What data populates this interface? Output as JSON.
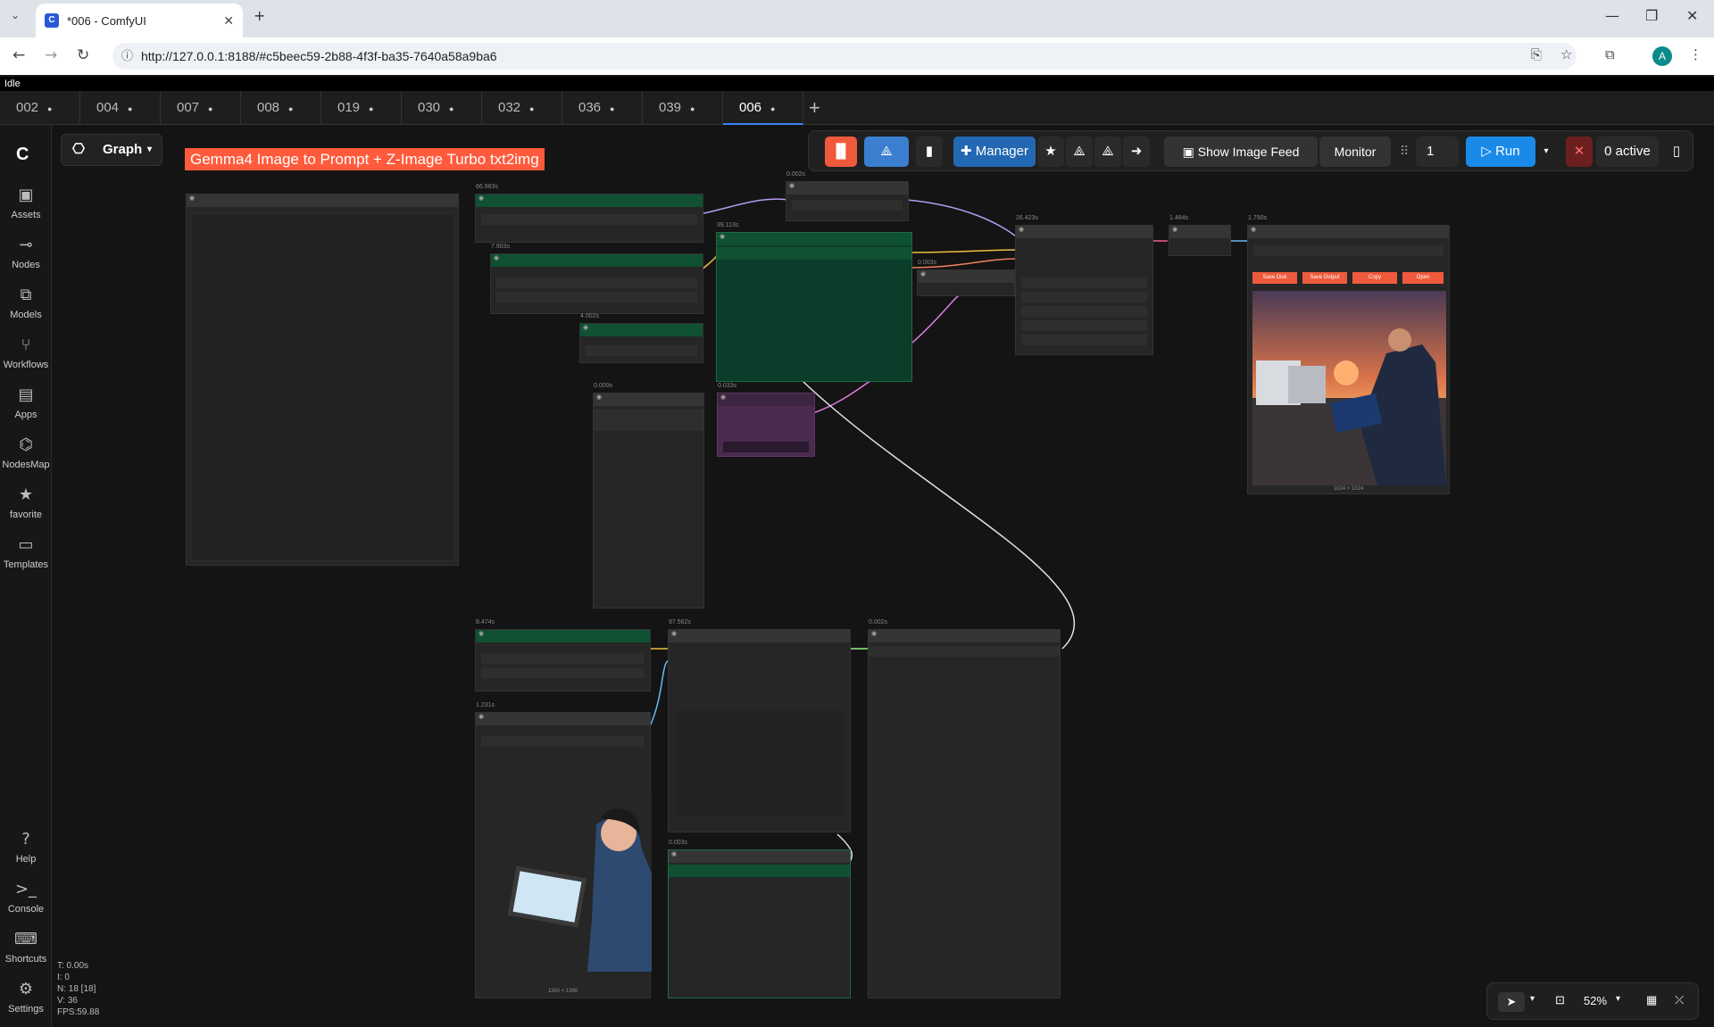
{
  "browser": {
    "tab_title": "*006 - ComfyUI",
    "url": "http://127.0.0.1:8188/#c5beec59-2b88-4f3f-ba35-7640a58a9ba6",
    "profile_initial": "A"
  },
  "status_strip": "Idle",
  "workflow_tabs": [
    "002",
    "004",
    "007",
    "008",
    "019",
    "030",
    "032",
    "036",
    "039",
    "006"
  ],
  "active_tab": "006",
  "sidebar": {
    "items": [
      {
        "label": "Assets",
        "icon": "image-icon"
      },
      {
        "label": "Nodes",
        "icon": "node-icon"
      },
      {
        "label": "Models",
        "icon": "models-icon"
      },
      {
        "label": "Workflows",
        "icon": "workflow-icon"
      },
      {
        "label": "Apps",
        "icon": "apps-icon"
      },
      {
        "label": "NodesMap",
        "icon": "nodesmap-icon"
      },
      {
        "label": "favorite",
        "icon": "star-icon"
      },
      {
        "label": "Templates",
        "icon": "templates-icon"
      }
    ],
    "bottom": [
      {
        "label": "Help",
        "icon": "help-icon"
      },
      {
        "label": "Console",
        "icon": "console-icon"
      },
      {
        "label": "Shortcuts",
        "icon": "keyboard-icon"
      },
      {
        "label": "Settings",
        "icon": "gear-icon"
      }
    ]
  },
  "graph_button": "Graph",
  "canvas_title": "Gemma4 Image to Prompt + Z-Image Turbo txt2img",
  "toolbar": {
    "manager": "Manager",
    "image_feed": "Show Image Feed",
    "monitor": "Monitor",
    "queue_count": "1",
    "run": "Run",
    "active": "0 active"
  },
  "output_node": {
    "buttons": [
      "Save Disk",
      "Save Output",
      "Copy",
      "Open"
    ],
    "caption": "1024 × 1024"
  },
  "input_image_caption": "1360 × 1360",
  "node_timings": [
    "66.983s",
    "7.903s",
    "4.002s",
    "0.002s",
    "39.113s",
    "0.003s",
    "26.423s",
    "1.484s",
    "1.790s",
    "0.000s",
    "0.033s",
    "8.474s",
    "97.562s",
    "0.002s",
    "1.231s",
    "0.003s"
  ],
  "stats": [
    "T: 0.00s",
    "I: 0",
    "N: 18 [18]",
    "V: 36",
    "FPS:59.88"
  ],
  "zoom": "52%"
}
